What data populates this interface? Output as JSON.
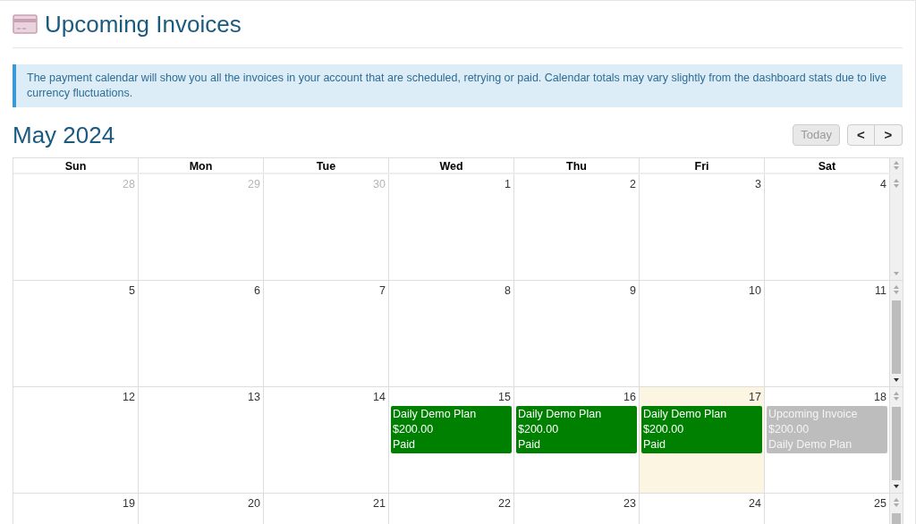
{
  "page": {
    "title": "Upcoming Invoices"
  },
  "alert": {
    "text": "The payment calendar will show you all the invoices in your account that are scheduled, retrying or paid. Calendar totals may vary slightly from the dashboard stats due to live currency fluctuations."
  },
  "calendar": {
    "month_title": "May 2024",
    "today_button": {
      "label": "Today",
      "disabled": true
    },
    "prev_label": "<",
    "next_label": ">",
    "weekdays": [
      "Sun",
      "Mon",
      "Tue",
      "Wed",
      "Thu",
      "Fri",
      "Sat"
    ],
    "weeks": [
      {
        "days": [
          {
            "number": "28",
            "other_month": true,
            "today": false
          },
          {
            "number": "29",
            "other_month": true,
            "today": false
          },
          {
            "number": "30",
            "other_month": true,
            "today": false
          },
          {
            "number": "1",
            "other_month": false,
            "today": false
          },
          {
            "number": "2",
            "other_month": false,
            "today": false
          },
          {
            "number": "3",
            "other_month": false,
            "today": false
          },
          {
            "number": "4",
            "other_month": false,
            "today": false
          }
        ]
      },
      {
        "days": [
          {
            "number": "5",
            "other_month": false,
            "today": false
          },
          {
            "number": "6",
            "other_month": false,
            "today": false
          },
          {
            "number": "7",
            "other_month": false,
            "today": false
          },
          {
            "number": "8",
            "other_month": false,
            "today": false
          },
          {
            "number": "9",
            "other_month": false,
            "today": false
          },
          {
            "number": "10",
            "other_month": false,
            "today": false
          },
          {
            "number": "11",
            "other_month": false,
            "today": false
          }
        ]
      },
      {
        "days": [
          {
            "number": "12",
            "other_month": false,
            "today": false
          },
          {
            "number": "13",
            "other_month": false,
            "today": false
          },
          {
            "number": "14",
            "other_month": false,
            "today": false
          },
          {
            "number": "15",
            "other_month": false,
            "today": false,
            "events": [
              {
                "kind": "paid",
                "lines": [
                  "Daily Demo Plan",
                  "$200.00",
                  "Paid"
                ]
              }
            ]
          },
          {
            "number": "16",
            "other_month": false,
            "today": false,
            "events": [
              {
                "kind": "paid",
                "lines": [
                  "Daily Demo Plan",
                  "$200.00",
                  "Paid"
                ]
              }
            ]
          },
          {
            "number": "17",
            "other_month": false,
            "today": true,
            "events": [
              {
                "kind": "paid",
                "lines": [
                  "Daily Demo Plan",
                  "$200.00",
                  "Paid"
                ]
              }
            ]
          },
          {
            "number": "18",
            "other_month": false,
            "today": false,
            "events": [
              {
                "kind": "upcoming",
                "lines": [
                  "Upcoming Invoice",
                  "$200.00",
                  "Daily Demo Plan"
                ]
              }
            ]
          }
        ]
      },
      {
        "days": [
          {
            "number": "19",
            "other_month": false,
            "today": false
          },
          {
            "number": "20",
            "other_month": false,
            "today": false
          },
          {
            "number": "21",
            "other_month": false,
            "today": false
          },
          {
            "number": "22",
            "other_month": false,
            "today": false
          },
          {
            "number": "23",
            "other_month": false,
            "today": false
          },
          {
            "number": "24",
            "other_month": false,
            "today": false
          },
          {
            "number": "25",
            "other_month": false,
            "today": false
          }
        ]
      }
    ]
  }
}
